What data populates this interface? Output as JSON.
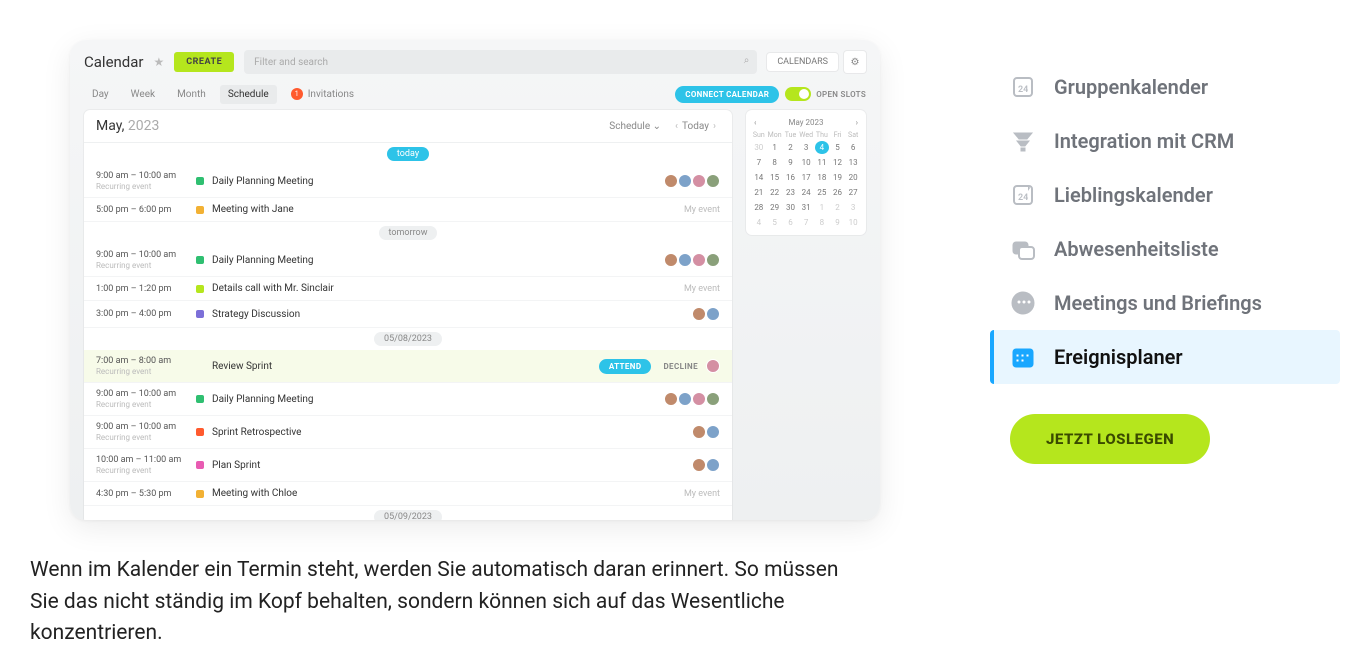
{
  "shot": {
    "title": "Calendar",
    "create": "CREATE",
    "search_placeholder": "Filter and search",
    "calendars_btn": "CALENDARS",
    "views": {
      "day": "Day",
      "week": "Week",
      "month": "Month",
      "schedule": "Schedule"
    },
    "invitations_label": "Invitations",
    "invitations_count": "1",
    "connect": "CONNECT CALENDAR",
    "open_slots": "OPEN SLOTS",
    "month": "May,",
    "year": "2023",
    "schedule_label": "Schedule",
    "today_label": "Today",
    "chips": {
      "today": "today",
      "tomorrow": "tomorrow",
      "d1": "05/08/2023",
      "d2": "05/09/2023"
    },
    "rows": [
      {
        "time": "9:00 am – 10:00 am",
        "sub": "Recurring event",
        "color": "#2fbf71",
        "title": "Daily Planning Meeting",
        "right": "avatars4"
      },
      {
        "time": "5:00 pm – 6:00 pm",
        "sub": "",
        "color": "#f2b134",
        "title": "Meeting with Jane",
        "right": "my"
      },
      {
        "time": "9:00 am – 10:00 am",
        "sub": "Recurring event",
        "color": "#2fbf71",
        "title": "Daily Planning Meeting",
        "right": "avatars4"
      },
      {
        "time": "1:00 pm – 1:20 pm",
        "sub": "",
        "color": "#b5e61d",
        "title": "Details call with Mr. Sinclair",
        "right": "my"
      },
      {
        "time": "3:00 pm – 4:00 pm",
        "sub": "",
        "color": "#7c6fd8",
        "title": "Strategy Discussion",
        "right": "avatars2"
      },
      {
        "time": "7:00 am – 8:00 am",
        "sub": "Recurring event",
        "color": "",
        "title": "Review Sprint",
        "right": "attend",
        "hl": true
      },
      {
        "time": "9:00 am – 10:00 am",
        "sub": "Recurring event",
        "color": "#2fbf71",
        "title": "Daily Planning Meeting",
        "right": "avatars4"
      },
      {
        "time": "9:00 am – 10:00 am",
        "sub": "Recurring event",
        "color": "#ff5a2e",
        "title": "Sprint Retrospective",
        "right": "avatars2"
      },
      {
        "time": "10:00 am – 11:00 am",
        "sub": "Recurring event",
        "color": "#e85bb2",
        "title": "Plan Sprint",
        "right": "avatars2"
      },
      {
        "time": "4:30 pm – 5:30 pm",
        "sub": "",
        "color": "#f2b134",
        "title": "Meeting with Chloe",
        "right": "my"
      }
    ],
    "attend": "ATTEND",
    "decline": "DECLINE",
    "my_event": "My event",
    "mini": {
      "title": "May 2023",
      "dow": [
        "Sun",
        "Mon",
        "Tue",
        "Wed",
        "Thu",
        "Fri",
        "Sat"
      ],
      "weeks": [
        [
          {
            "n": "30",
            "m": 1
          },
          {
            "n": "1"
          },
          {
            "n": "2"
          },
          {
            "n": "3"
          },
          {
            "n": "4",
            "sel": 1
          },
          {
            "n": "5"
          },
          {
            "n": "6"
          }
        ],
        [
          {
            "n": "7"
          },
          {
            "n": "8"
          },
          {
            "n": "9"
          },
          {
            "n": "10"
          },
          {
            "n": "11"
          },
          {
            "n": "12"
          },
          {
            "n": "13"
          }
        ],
        [
          {
            "n": "14"
          },
          {
            "n": "15"
          },
          {
            "n": "16"
          },
          {
            "n": "17"
          },
          {
            "n": "18"
          },
          {
            "n": "19"
          },
          {
            "n": "20"
          }
        ],
        [
          {
            "n": "21"
          },
          {
            "n": "22"
          },
          {
            "n": "23"
          },
          {
            "n": "24"
          },
          {
            "n": "25"
          },
          {
            "n": "26"
          },
          {
            "n": "27"
          }
        ],
        [
          {
            "n": "28"
          },
          {
            "n": "29"
          },
          {
            "n": "30"
          },
          {
            "n": "31"
          },
          {
            "n": "1",
            "m": 1
          },
          {
            "n": "2",
            "m": 1
          },
          {
            "n": "3",
            "m": 1
          }
        ],
        [
          {
            "n": "4",
            "m": 1
          },
          {
            "n": "5",
            "m": 1
          },
          {
            "n": "6",
            "m": 1
          },
          {
            "n": "7",
            "m": 1
          },
          {
            "n": "8",
            "m": 1
          },
          {
            "n": "9",
            "m": 1
          },
          {
            "n": "10",
            "m": 1
          }
        ]
      ]
    }
  },
  "features": [
    {
      "id": "group",
      "label": "Gruppenkalender"
    },
    {
      "id": "crm",
      "label": "Integration mit CRM"
    },
    {
      "id": "fav",
      "label": "Lieblingskalender"
    },
    {
      "id": "abs",
      "label": "Abwesenheitsliste"
    },
    {
      "id": "meet",
      "label": "Meetings und Briefings"
    },
    {
      "id": "plan",
      "label": "Ereignisplaner",
      "active": true
    }
  ],
  "cta": "JETZT LOSLEGEN",
  "paragraph": "Wenn im Kalender ein Termin steht, werden Sie automatisch daran erinnert. So müssen Sie das nicht ständig im Kopf behalten, sondern können sich auf das Wesentliche konzentrieren."
}
